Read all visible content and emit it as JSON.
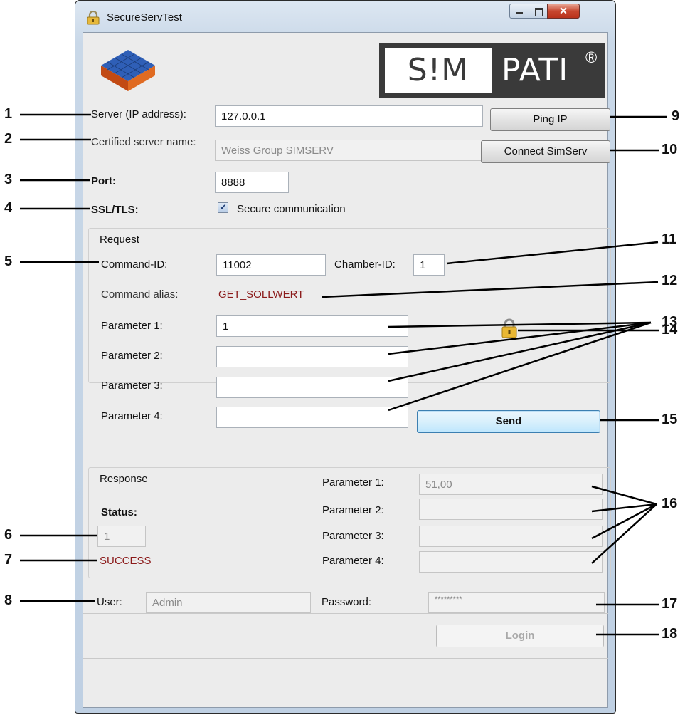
{
  "window": {
    "title": "SecureServTest"
  },
  "logo": {
    "brand_left": "S!M",
    "brand_right": "PATI",
    "reg": "®"
  },
  "connection": {
    "server_label": "Server (IP address):",
    "server_value": "127.0.0.1",
    "cert_label": "Certified server name:",
    "cert_value": "Weiss Group SIMSERV",
    "port_label": "Port:",
    "port_value": "8888",
    "ssl_label": "SSL/TLS:",
    "secure_label": "Secure communication",
    "ping_button": "Ping IP",
    "connect_button": "Connect SimServ"
  },
  "request": {
    "group_label": "Request",
    "command_id_label": "Command-ID:",
    "command_id_value": "11002",
    "chamber_id_label": "Chamber-ID:",
    "chamber_id_value": "1",
    "alias_label": "Command alias:",
    "alias_value": "GET_SOLLWERT",
    "p1_label": "Parameter 1:",
    "p1_value": "1",
    "p2_label": "Parameter 2:",
    "p2_value": "",
    "p3_label": "Parameter 3:",
    "p3_value": "",
    "p4_label": "Parameter 4:",
    "p4_value": "",
    "send_button": "Send"
  },
  "response": {
    "group_label": "Response",
    "status_label": "Status:",
    "status_code": "1",
    "status_text": "SUCCESS",
    "p1_label": "Parameter 1:",
    "p1_value": "51,00",
    "p2_label": "Parameter 2:",
    "p2_value": "",
    "p3_label": "Parameter 3:",
    "p3_value": "",
    "p4_label": "Parameter 4:",
    "p4_value": ""
  },
  "login": {
    "user_label": "User:",
    "user_value": "Admin",
    "password_label": "Password:",
    "password_value": "*********",
    "login_button": "Login"
  },
  "callouts": {
    "n1": "1",
    "n2": "2",
    "n3": "3",
    "n4": "4",
    "n5": "5",
    "n6": "6",
    "n7": "7",
    "n8": "8",
    "n9": "9",
    "n10": "10",
    "n11": "11",
    "n12": "12",
    "n13": "13",
    "n14": "14",
    "n15": "15",
    "n16": "16",
    "n17": "17",
    "n18": "18"
  },
  "colors": {
    "status_red": "#8b1a1a",
    "window_frame": "#c9d8e8"
  }
}
